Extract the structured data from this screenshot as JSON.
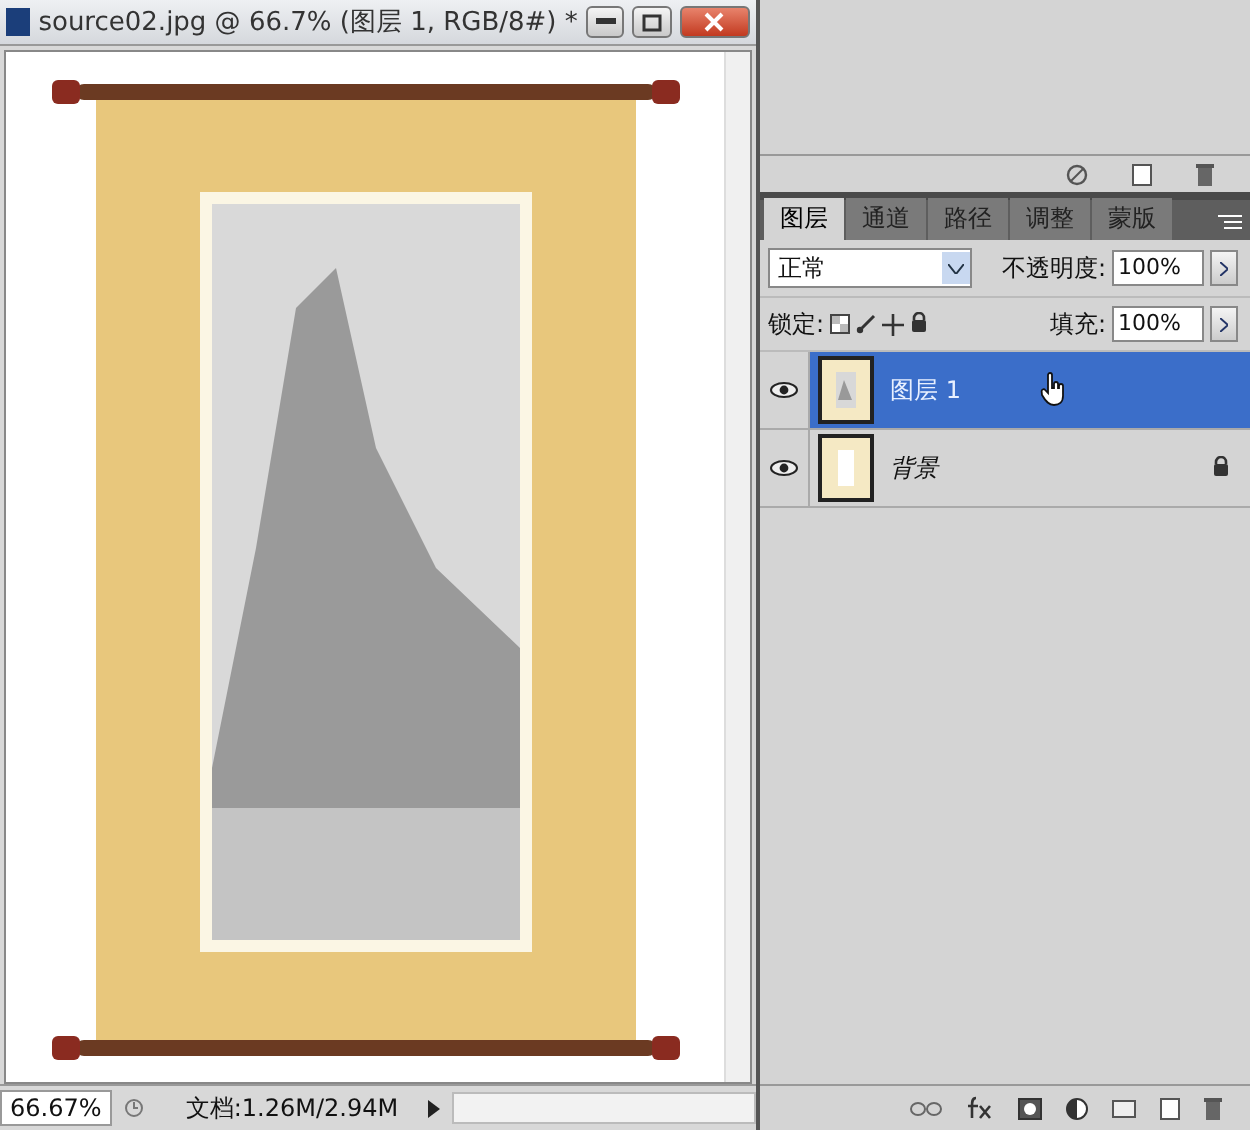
{
  "document_window": {
    "title": "source02.jpg @ 66.7% (图层 1, RGB/8#) *"
  },
  "status_bar": {
    "zoom": "66.67%",
    "doc_info": "文档:1.26M/2.94M"
  },
  "layers_panel": {
    "tabs": [
      {
        "label": "图层",
        "selected": true
      },
      {
        "label": "通道",
        "selected": false
      },
      {
        "label": "路径",
        "selected": false
      },
      {
        "label": "调整",
        "selected": false
      },
      {
        "label": "蒙版",
        "selected": false
      }
    ],
    "blend_mode": "正常",
    "opacity_label": "不透明度:",
    "opacity": "100%",
    "lock_label": "锁定:",
    "fill_label": "填充:",
    "fill": "100%",
    "layers": [
      {
        "name": "图层 1",
        "kind": "normal",
        "selected": true,
        "visible": true,
        "locked": false
      },
      {
        "name": "背景",
        "kind": "background",
        "selected": false,
        "visible": true,
        "locked": true
      }
    ]
  }
}
